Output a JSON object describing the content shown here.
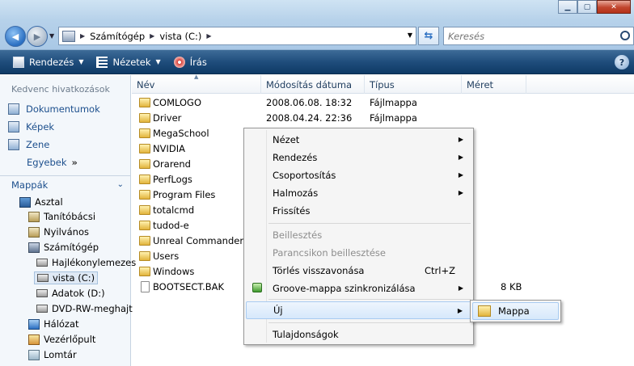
{
  "address": {
    "crumbs": [
      "Számítógép",
      "vista (C:)"
    ]
  },
  "search": {
    "placeholder": "Keresés"
  },
  "toolbar": {
    "organize_label": "Rendezés",
    "views_label": "Nézetek",
    "burn_label": "Írás"
  },
  "sidebar": {
    "favorites_heading": "Kedvenc hivatkozások",
    "favorites": [
      "Dokumentumok",
      "Képek",
      "Zene"
    ],
    "more_label": "Egyebek",
    "folders_heading": "Mappák",
    "tree": [
      {
        "label": "Asztal",
        "icon": "desktop-icon"
      },
      {
        "label": "Tanítóbácsi",
        "icon": "user-folder-icon"
      },
      {
        "label": "Nyilvános",
        "icon": "public-folder-icon"
      },
      {
        "label": "Számítógép",
        "icon": "computer-icon"
      },
      {
        "label": "Hajlékonylemezes",
        "icon": "floppy-drive-icon"
      },
      {
        "label": "vista (C:)",
        "icon": "hard-drive-icon"
      },
      {
        "label": "Adatok (D:)",
        "icon": "hard-drive-icon"
      },
      {
        "label": "DVD-RW-meghajt",
        "icon": "dvd-drive-icon"
      },
      {
        "label": "Hálózat",
        "icon": "network-icon"
      },
      {
        "label": "Vezérlőpult",
        "icon": "control-panel-icon"
      },
      {
        "label": "Lomtár",
        "icon": "recycle-bin-icon"
      }
    ]
  },
  "columns": {
    "name": "Név",
    "modified": "Módosítás dátuma",
    "type": "Típus",
    "size": "Méret"
  },
  "files": [
    {
      "name": "COMLOGO",
      "date": "2008.06.08. 18:32",
      "type": "Fájlmappa",
      "size": ""
    },
    {
      "name": "Driver",
      "date": "2008.04.24. 22:36",
      "type": "Fájlmappa",
      "size": ""
    },
    {
      "name": "MegaSchool",
      "date": "",
      "type": "",
      "size": ""
    },
    {
      "name": "NVIDIA",
      "date": "",
      "type": "",
      "size": ""
    },
    {
      "name": "Orarend",
      "date": "",
      "type": "",
      "size": ""
    },
    {
      "name": "PerfLogs",
      "date": "",
      "type": "",
      "size": ""
    },
    {
      "name": "Program Files",
      "date": "",
      "type": "",
      "size": ""
    },
    {
      "name": "totalcmd",
      "date": "",
      "type": "",
      "size": ""
    },
    {
      "name": "tudod-e",
      "date": "",
      "type": "",
      "size": ""
    },
    {
      "name": "Unreal Commander",
      "date": "",
      "type": "",
      "size": ""
    },
    {
      "name": "Users",
      "date": "",
      "type": "",
      "size": ""
    },
    {
      "name": "Windows",
      "date": "",
      "type": "",
      "size": ""
    },
    {
      "name": "BOOTSECT.BAK",
      "date": "",
      "type": "",
      "size": "8 KB"
    }
  ],
  "context_menu": {
    "view": "Nézet",
    "sort": "Rendezés",
    "group": "Csoportosítás",
    "stack": "Halmozás",
    "refresh": "Frissítés",
    "paste": "Beillesztés",
    "paste_shortcut": "Parancsikon beillesztése",
    "undo_delete": "Törlés visszavonása",
    "undo_shortcut": "Ctrl+Z",
    "groove_sync": "Groove-mappa szinkronizálása",
    "new": "Új",
    "properties": "Tulajdonságok"
  },
  "submenu": {
    "folder": "Mappa"
  }
}
